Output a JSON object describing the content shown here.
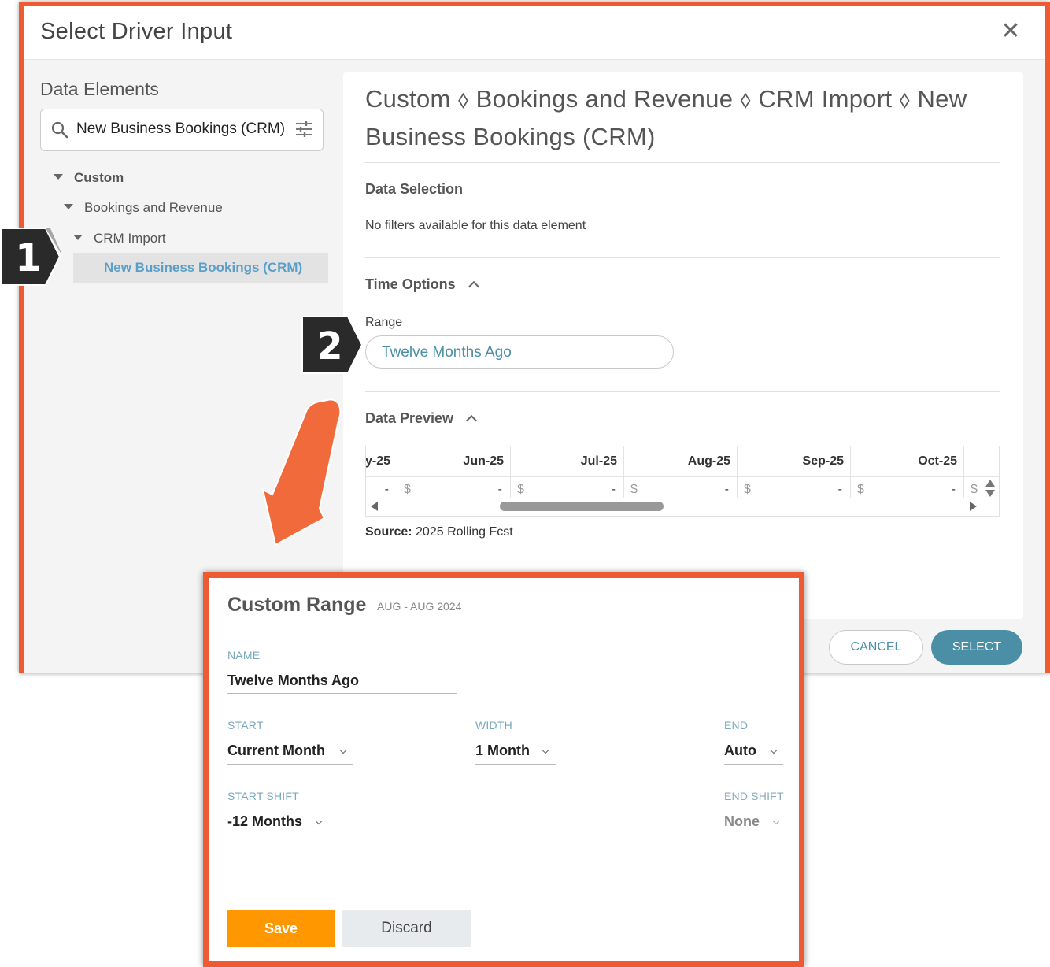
{
  "dialog": {
    "title": "Select Driver Input",
    "close_icon": "close-icon"
  },
  "left": {
    "title": "Data Elements",
    "search_value": "New Business Bookings (CRM)",
    "tree": [
      {
        "label": "Custom"
      },
      {
        "label": "Bookings and Revenue"
      },
      {
        "label": "CRM Import"
      },
      {
        "label": "New Business Bookings (CRM)",
        "selected": true
      }
    ]
  },
  "right": {
    "breadcrumb": "Custom ⬨ Bookings and Revenue ⬨ CRM Import ⬨ New Business Bookings (CRM)",
    "data_selection_title": "Data Selection",
    "no_filters": "No filters available for this data element",
    "time_options_title": "Time Options",
    "range_label": "Range",
    "range_value": "Twelve Months Ago",
    "data_preview_title": "Data Preview",
    "preview_columns": [
      "y-25",
      "Jun-25",
      "Jul-25",
      "Aug-25",
      "Sep-25",
      "Oct-25"
    ],
    "preview_dollar": "$",
    "preview_dash": "-",
    "source_label": "Source:",
    "source_value": "2025 Rolling Fcst"
  },
  "footer": {
    "cancel": "CANCEL",
    "select": "SELECT"
  },
  "callouts": {
    "one": "1",
    "two": "2"
  },
  "custom_range": {
    "title": "Custom Range",
    "subtitle": "AUG - AUG 2024",
    "name_label": "NAME",
    "name_value": "Twelve Months Ago",
    "start_label": "START",
    "start_value": "Current Month",
    "width_label": "WIDTH",
    "width_value": "1 Month",
    "end_label": "END",
    "end_value": "Auto",
    "start_shift_label": "START SHIFT",
    "start_shift_value": "-12 Months",
    "end_shift_label": "END SHIFT",
    "end_shift_value": "None",
    "save": "Save",
    "discard": "Discard"
  },
  "colors": {
    "highlight": "#ee5a32",
    "accent": "#4a8fa5",
    "save": "#ff9800"
  }
}
